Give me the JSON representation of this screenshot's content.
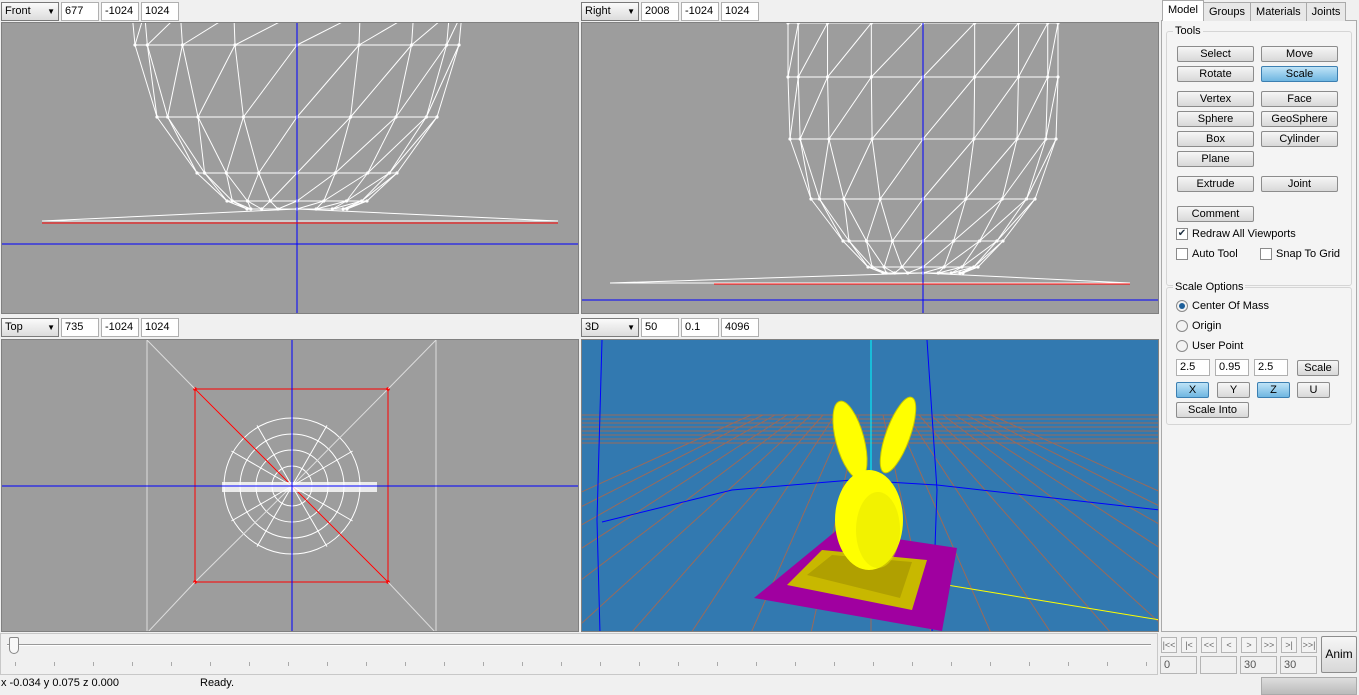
{
  "viewports": [
    {
      "view": "Front",
      "v1": "677",
      "v2": "-1024",
      "v3": "1024"
    },
    {
      "view": "Right",
      "v1": "2008",
      "v2": "-1024",
      "v3": "1024"
    },
    {
      "view": "Top",
      "v1": "735",
      "v2": "-1024",
      "v3": "1024"
    },
    {
      "view": "3D",
      "v1": "50",
      "v2": "0.1",
      "v3": "4096"
    }
  ],
  "colors": {
    "viewport_bg": "#9d9d9d",
    "viewport_3d_bg": "#3279b0",
    "axis": "#0000ff",
    "selection": "#ff0000",
    "wire": "#ffffff",
    "model": "#ffff00",
    "base": "#a000a0"
  },
  "panel": {
    "tabs": [
      "Model",
      "Groups",
      "Materials",
      "Joints"
    ],
    "active_tab": "Model",
    "tools_label": "Tools",
    "tools": {
      "select": "Select",
      "move": "Move",
      "rotate": "Rotate",
      "scale": "Scale",
      "vertex": "Vertex",
      "face": "Face",
      "sphere": "Sphere",
      "geosphere": "GeoSphere",
      "box": "Box",
      "cylinder": "Cylinder",
      "plane": "Plane",
      "extrude": "Extrude",
      "joint": "Joint",
      "comment": "Comment"
    },
    "active_tool": "Scale",
    "redraw_all": {
      "label": "Redraw All Viewports",
      "checked": true
    },
    "auto_tool": {
      "label": "Auto Tool",
      "checked": false
    },
    "snap_to_grid": {
      "label": "Snap To Grid",
      "checked": false
    },
    "scale_options": {
      "label": "Scale Options",
      "center_of_mass": "Center Of Mass",
      "origin": "Origin",
      "user_point": "User Point",
      "selected": "Center Of Mass",
      "x": "2.5",
      "y": "0.95",
      "z": "2.5",
      "scale_btn": "Scale",
      "axis_x": "X",
      "axis_y": "Y",
      "axis_z": "Z",
      "axis_u": "U",
      "scale_into": "Scale Into"
    }
  },
  "timeline": {
    "buttons": [
      "|<<",
      "|<",
      "<<",
      "<",
      ">",
      ">>",
      ">|",
      ">>|"
    ],
    "start": "0",
    "current": "",
    "end": "30",
    "total": "30",
    "anim": "Anim",
    "position": 0
  },
  "status": {
    "coords": "x -0.034 y 0.075 z 0.000",
    "message": "Ready."
  }
}
